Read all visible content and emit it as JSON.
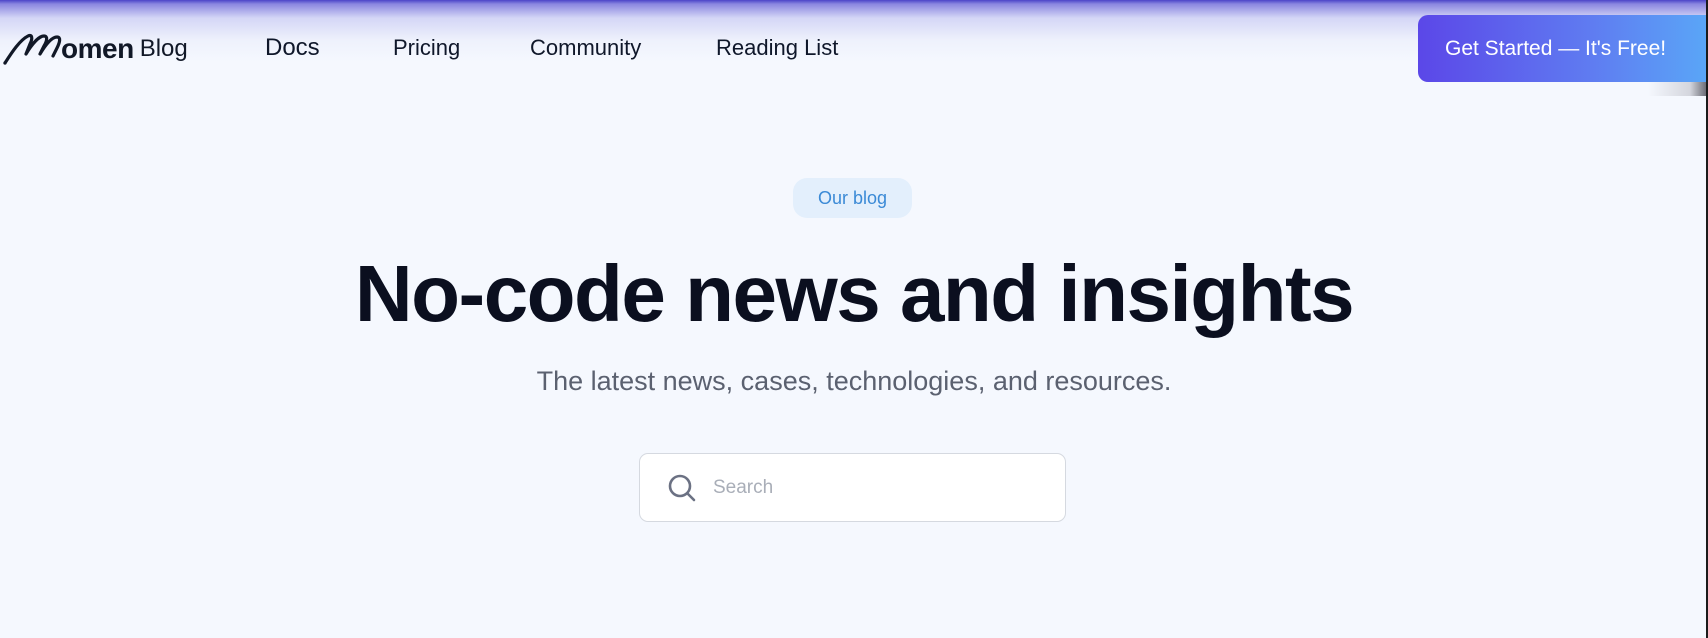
{
  "nav": {
    "logo": {
      "wordmark": "omen",
      "product": "Blog"
    },
    "links": [
      "Docs",
      "Pricing",
      "Community",
      "Reading List"
    ],
    "cta_label": "Get Started — It's Free!"
  },
  "hero": {
    "badge": "Our blog",
    "title": "No-code news and insights",
    "subtitle": "The latest news, cases, technologies, and resources.",
    "search": {
      "placeholder": "Search",
      "value": ""
    }
  },
  "colors": {
    "background": "#f5f8fe",
    "cta_gradient_start": "#5b47e8",
    "cta_gradient_end": "#5aa6f7",
    "badge_bg": "#e3effc",
    "badge_text": "#3b8ad6",
    "heading": "#0b0f1f",
    "muted": "#5b6170"
  },
  "icons": {
    "logo": "momen-logo-icon",
    "search": "search-icon"
  }
}
